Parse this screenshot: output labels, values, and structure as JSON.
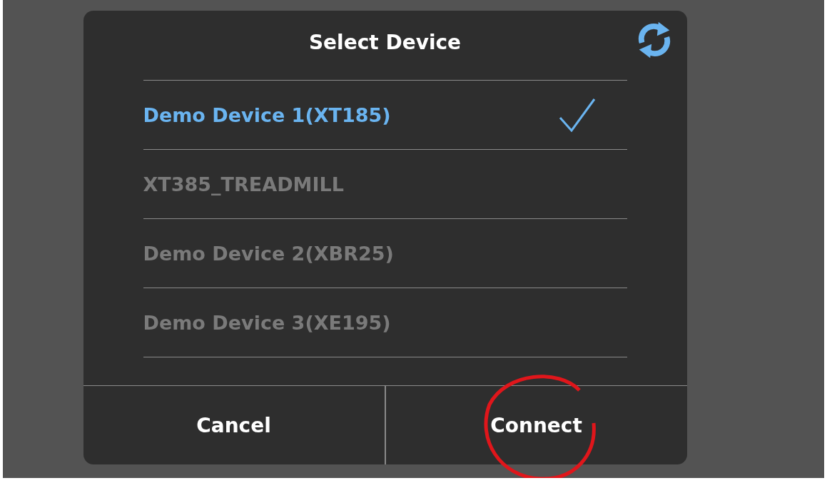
{
  "dialog": {
    "title": "Select Device",
    "devices": [
      {
        "name": "Demo Device 1(XT185)",
        "selected": true
      },
      {
        "name": "XT385_TREADMILL",
        "selected": false
      },
      {
        "name": "Demo Device 2(XBR25)",
        "selected": false
      },
      {
        "name": "Demo Device 3(XE195)",
        "selected": false
      }
    ],
    "buttons": [
      {
        "label": "Cancel",
        "highlighted": false
      },
      {
        "label": "Connect",
        "highlighted": true
      }
    ]
  }
}
